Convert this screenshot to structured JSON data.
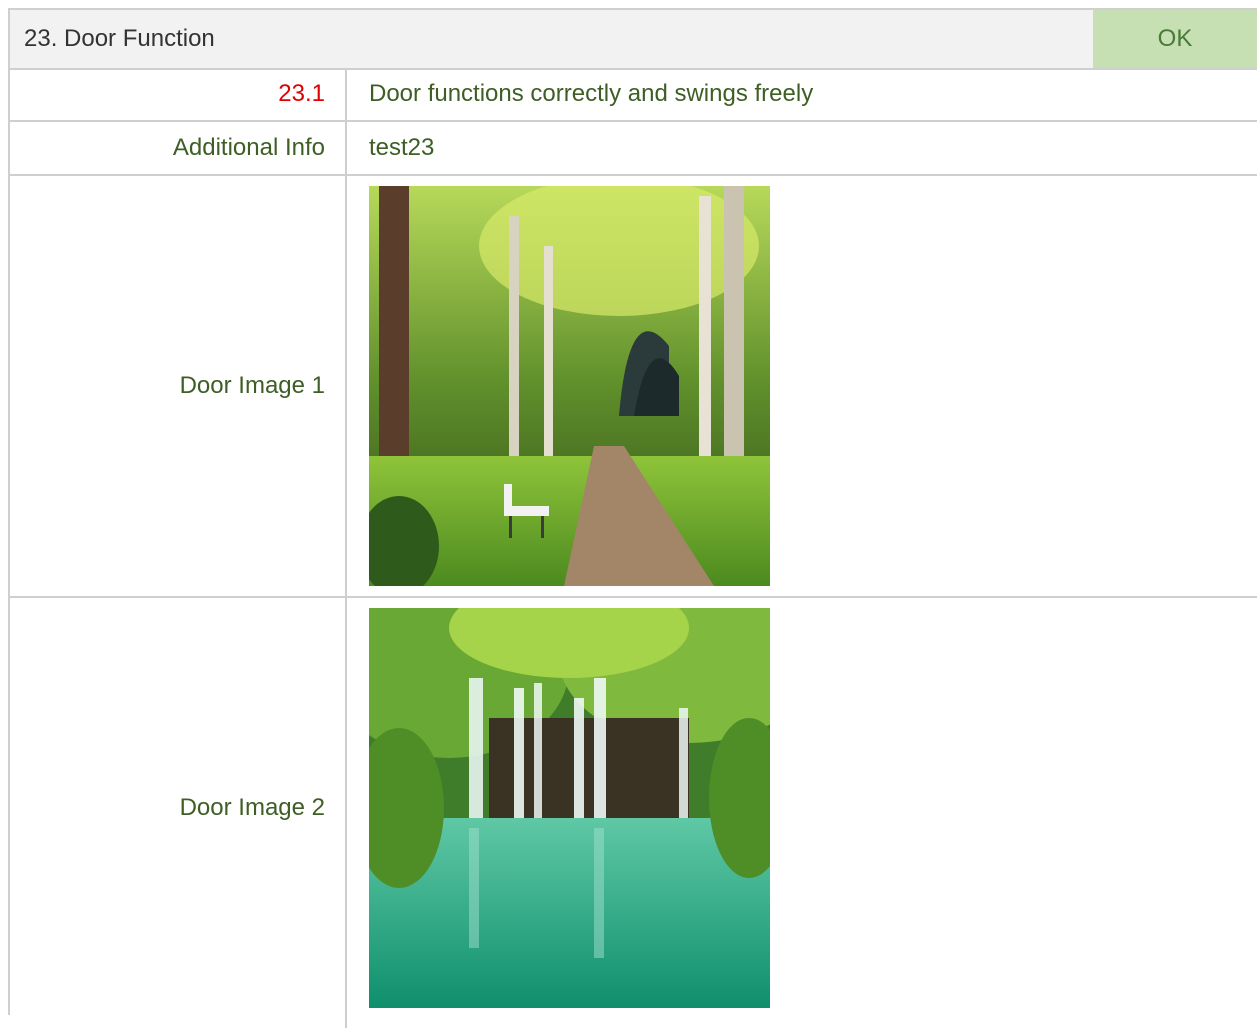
{
  "section": {
    "title": "23. Door Function",
    "status": "OK"
  },
  "rows": [
    {
      "label": "23.1",
      "value": "Door functions correctly and swings freely"
    },
    {
      "label": "Additional Info",
      "value": "test23"
    }
  ],
  "images": [
    {
      "label": "Door Image 1",
      "icon": "park-path-photo"
    },
    {
      "label": "Door Image 2",
      "icon": "waterfall-lake-photo"
    }
  ],
  "colors": {
    "status_bg": "#c6e0b4",
    "label_text": "#3e5e25",
    "number_text": "#e00000"
  }
}
